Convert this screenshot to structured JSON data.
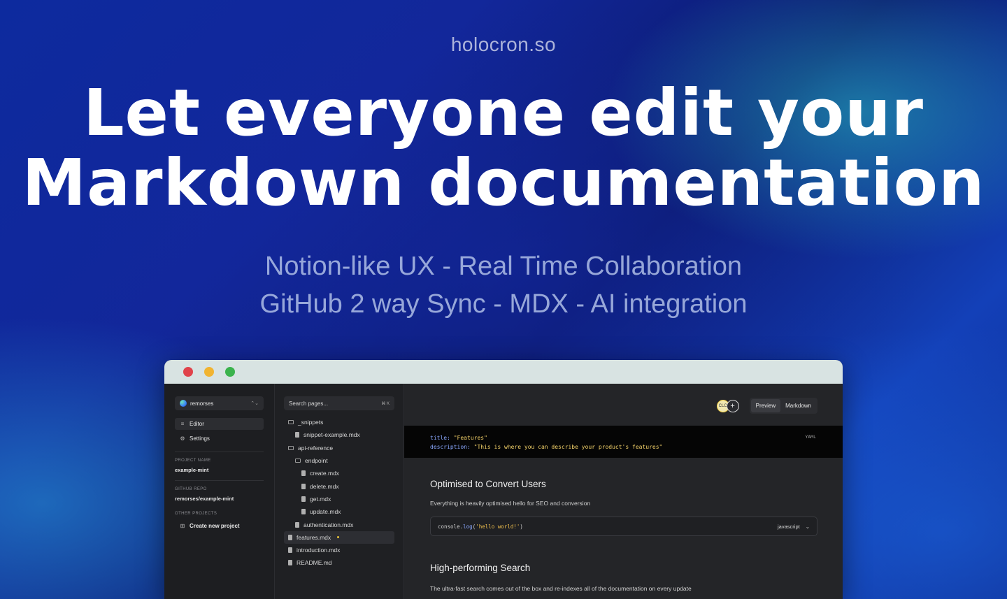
{
  "hero": {
    "brand": "holocron.so",
    "headline_line1": "Let everyone edit your",
    "headline_line2": "Markdown documentation",
    "tagline_line1": "Notion-like UX - Real Time Collaboration",
    "tagline_line2": "GitHub 2 way Sync - MDX - AI integration"
  },
  "window": {
    "controls": [
      "close",
      "minimize",
      "maximize"
    ]
  },
  "sidebar": {
    "project": "remorses",
    "nav": [
      {
        "label": "Editor",
        "icon": "menu-icon",
        "active": true
      },
      {
        "label": "Settings",
        "icon": "settings-icon",
        "active": false
      }
    ],
    "project_name_label": "PROJECT NAME",
    "project_name": "example-mint",
    "github_repo_label": "GITHUB REPO",
    "github_repo": "remorses/example-mint",
    "other_projects_label": "OTHER PROJECTS",
    "create_project": "Create new project"
  },
  "filetree": {
    "search_placeholder": "Search pages...",
    "shortcut": "⌘ K",
    "items": [
      {
        "label": "_snippets",
        "type": "folder",
        "depth": 0
      },
      {
        "label": "snippet-example.mdx",
        "type": "file",
        "depth": 1
      },
      {
        "label": "api-reference",
        "type": "folder",
        "depth": 0
      },
      {
        "label": "endpoint",
        "type": "folder",
        "depth": 1
      },
      {
        "label": "create.mdx",
        "type": "file",
        "depth": 2
      },
      {
        "label": "delete.mdx",
        "type": "file",
        "depth": 2
      },
      {
        "label": "get.mdx",
        "type": "file",
        "depth": 2
      },
      {
        "label": "update.mdx",
        "type": "file",
        "depth": 2
      },
      {
        "label": "authentication.mdx",
        "type": "file",
        "depth": 1
      },
      {
        "label": "features.mdx",
        "type": "file",
        "depth": 0,
        "selected": true,
        "modified": true
      },
      {
        "label": "introduction.mdx",
        "type": "file",
        "depth": 0
      },
      {
        "label": "README.md",
        "type": "file",
        "depth": 0
      }
    ]
  },
  "editor": {
    "avatar_initials": "CLC",
    "add_symbol": "+",
    "toggle": [
      "Preview",
      "Markdown"
    ],
    "yaml_label": "YAML",
    "frontmatter": {
      "title_key": "title",
      "title_val": "\"Features\"",
      "desc_key": "description",
      "desc_val": "\"This is where you can describe your product's features\""
    },
    "section1_title": "Optimised to Convert Users",
    "section1_text": "Everything is heavily optimised hello for SEO and conversion",
    "code": {
      "obj": "console",
      "fn": "log",
      "arg": "'hello world!'",
      "language": "javascript"
    },
    "section2_title": "High-performing Search",
    "section2_text": "The ultra-fast search comes out of the box and re-indexes all of the documentation on every update"
  }
}
